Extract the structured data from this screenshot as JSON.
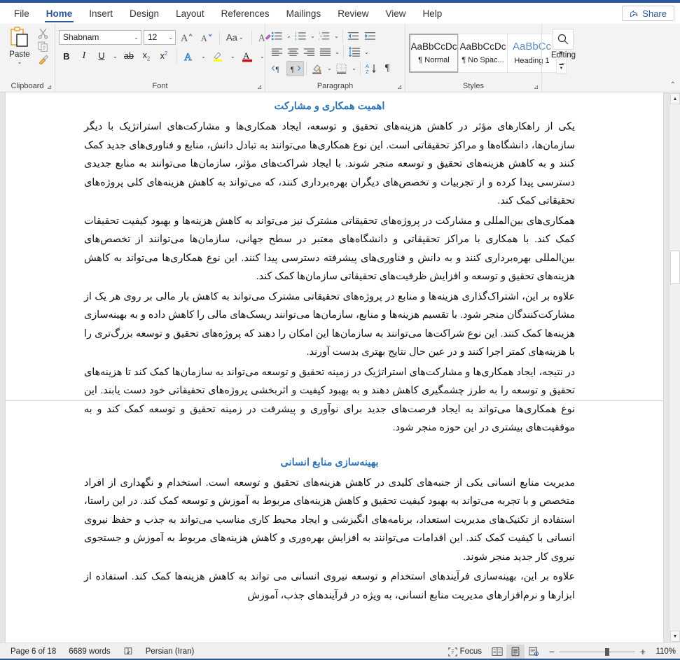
{
  "window": {
    "accent_color": "#2b579a",
    "heading_color": "#2e74b5"
  },
  "tabs": [
    {
      "label": "File",
      "active": false
    },
    {
      "label": "Home",
      "active": true
    },
    {
      "label": "Insert",
      "active": false
    },
    {
      "label": "Design",
      "active": false
    },
    {
      "label": "Layout",
      "active": false
    },
    {
      "label": "References",
      "active": false
    },
    {
      "label": "Mailings",
      "active": false
    },
    {
      "label": "Review",
      "active": false
    },
    {
      "label": "View",
      "active": false
    },
    {
      "label": "Help",
      "active": false
    }
  ],
  "share": {
    "label": "Share"
  },
  "ribbon": {
    "clipboard": {
      "group_label": "Clipboard",
      "paste_label": "Paste",
      "cut_label": "Cut",
      "copy_label": "Copy",
      "format_painter_label": "Format Painter"
    },
    "font": {
      "group_label": "Font",
      "font_name": "Shabnam",
      "font_size": "12",
      "grow_font_label": "A",
      "shrink_font_label": "A",
      "change_case_label": "Aa",
      "clear_formatting_label": "A",
      "bold_label": "B",
      "italic_label": "I",
      "underline_label": "U",
      "strikethrough_label": "ab",
      "subscript_label": "x",
      "superscript_label": "x",
      "text_effects_label": "A",
      "highlight_label": "A",
      "font_color_label": "A"
    },
    "paragraph": {
      "group_label": "Paragraph",
      "bullets_label": "Bullets",
      "numbering_label": "Numbering",
      "multilevel_label": "Multilevel List",
      "decrease_indent_label": "Decrease Indent",
      "increase_indent_label": "Increase Indent",
      "align_left_label": "Align Left",
      "align_center_label": "Center",
      "align_right_label": "Align Right",
      "justify_label": "Justify",
      "line_spacing_label": "Line and Paragraph Spacing",
      "ltr_label": "Left-to-Right Text Direction",
      "rtl_label": "Right-to-Left Text Direction",
      "shading_label": "Shading",
      "borders_label": "Borders",
      "sort_label": "Sort",
      "show_marks_label": "¶"
    },
    "styles": {
      "group_label": "Styles",
      "items": [
        {
          "preview": "AaBbCcDc",
          "name": "¶ Normal",
          "selected": true
        },
        {
          "preview": "AaBbCcDc",
          "name": "¶ No Spac...",
          "selected": false
        },
        {
          "preview": "AaBbCc",
          "name": "Heading 1",
          "selected": false
        }
      ],
      "scroll_up": "▲",
      "scroll_down": "▼",
      "more": "▼"
    },
    "editing": {
      "group_label": "Editing",
      "icon": "search-icon",
      "chevron": "⌄"
    },
    "collapse_label": "^"
  },
  "document": {
    "blocks": [
      {
        "type": "heading",
        "text": "اهمیت همکاری و مشارکت"
      },
      {
        "type": "paragraph",
        "text": "یکی از راهکارهای مؤثر در کاهش هزینه‌های تحقیق و توسعه، ایجاد همکاری‌ها و مشارکت‌های استراتژیک با دیگر سازمان‌ها، دانشگاه‌ها و مراکز تحقیقاتی است. این نوع همکاری‌ها می‌توانند به تبادل دانش، منابع و فناوری‌های جدید کمک کنند و به کاهش هزینه‌های تحقیق و توسعه منجر شوند. با ایجاد شراکت‌های مؤثر، سازمان‌ها می‌توانند به منابع جدیدی دسترسی پیدا کرده و از تجربیات و تخصص‌های دیگران بهره‌برداری کنند، که می‌تواند به کاهش هزینه‌های کلی پروژه‌های تحقیقاتی کمک کند."
      },
      {
        "type": "paragraph",
        "text": "همکاری‌های بین‌المللی و مشارکت در پروژه‌های تحقیقاتی مشترک نیز می‌تواند به کاهش هزینه‌ها و بهبود کیفیت تحقیقات کمک کند. با همکاری با مراکز تحقیقاتی و دانشگاه‌های معتبر در سطح جهانی، سازمان‌ها می‌توانند از تخصص‌های بین‌المللی بهره‌برداری کنند و به دانش و فناوری‌های پیشرفته دسترسی پیدا کنند. این نوع همکاری‌ها می‌تواند به کاهش هزینه‌های تحقیق و توسعه و افزایش ظرفیت‌های تحقیقاتی سازمان‌ها کمک کند."
      },
      {
        "type": "paragraph",
        "text": "علاوه بر این، اشتراک‌گذاری هزینه‌ها و منابع در پروژه‌های تحقیقاتی مشترک می‌تواند به کاهش بار مالی بر روی هر یک از مشارکت‌کنندگان منجر شود. با تقسیم هزینه‌ها و منابع، سازمان‌ها می‌توانند ریسک‌های مالی را کاهش داده و به بهینه‌سازی هزینه‌ها کمک کنند. این نوع شراکت‌ها می‌توانند به سازمان‌ها این امکان را دهند که پروژه‌های تحقیق و توسعه بزرگ‌تری را با هزینه‌های کمتر اجرا کنند و در عین حال نتایج بهتری بدست آورند."
      },
      {
        "type": "paragraph",
        "text": "در نتیجه، ایجاد همکاری‌ها و مشارکت‌های استراتژیک در زمینه تحقیق و توسعه می‌تواند به سازمان‌ها کمک کند تا هزینه‌های تحقیق و توسعه را به طرز چشمگیری کاهش دهند و به بهبود کیفیت و اثربخشی پروژه‌های تحقیقاتی خود دست یابند. این نوع همکاری‌ها می‌تواند به ایجاد فرصت‌های جدید برای نوآوری و پیشرفت در زمینه تحقیق و توسعه کمک کند و به موفقیت‌های بیشتری در این حوزه منجر شود."
      },
      {
        "type": "heading",
        "text": "بهینه‌سازی منابع انسانی"
      },
      {
        "type": "paragraph",
        "text": "مدیریت منابع انسانی یکی از جنبه‌های کلیدی در کاهش هزینه‌های تحقیق و توسعه است. استخدام و نگهداری از افراد متخصص و با تجربه می‌تواند به بهبود کیفیت تحقیق و کاهش هزینه‌های مربوط به آموزش و توسعه کمک کند. در این راستا، استفاده از تکنیک‌های مدیریت استعداد، برنامه‌های انگیزشی و ایجاد محیط کاری مناسب می‌تواند به جذب و حفظ نیروی انسانی با کیفیت کمک کند. این اقدامات می‌توانند به افزایش بهره‌وری و کاهش هزینه‌های مربوط به آموزش و جستجوی نیروی کار جدید منجر شوند."
      },
      {
        "type": "paragraph",
        "text": "علاوه بر این، بهینه‌سازی فرآیندهای استخدام و توسعه نیروی انسانی می تواند به کاهش هزینه‌ها کمک کند. استفاده از ابزارها و نرم‌افزارهای مدیریت منابع انسانی، به ویژه در فرآیندهای جذب، آموزش"
      }
    ]
  },
  "status": {
    "page_label": "Page 6 of 18",
    "word_count": "6689 words",
    "proofing_icon": "proofing-icon",
    "language": "Persian (Iran)",
    "focus_label": "Focus",
    "read_mode_label": "Read Mode",
    "print_layout_label": "Print Layout",
    "web_layout_label": "Web Layout",
    "zoom_out": "−",
    "zoom_in": "+",
    "zoom_level": "110%"
  }
}
